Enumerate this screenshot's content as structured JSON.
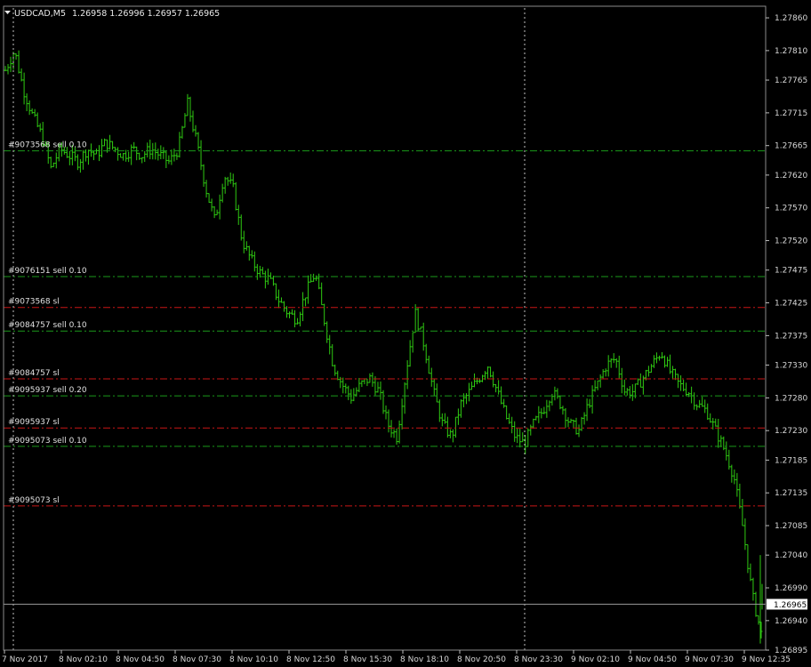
{
  "header": {
    "symbol": "USDCAD,M5",
    "ohlc": "1.26958 1.26996 1.26957 1.26965",
    "menu_icon": "triangle-down-icon"
  },
  "colors": {
    "background": "#000000",
    "candle": "#2fcb12",
    "sell_line": "#1a9a1a",
    "sl_line": "#c81616",
    "grid": "#c0c0c0",
    "frame": "#8a8a8a",
    "current_price_box": "#ffffff"
  },
  "orders": [
    {
      "text": "#9073568 sell 0.10",
      "price": 1.27657,
      "kind": "sell"
    },
    {
      "text": "#9076151 sell 0.10",
      "price": 1.27465,
      "kind": "sell"
    },
    {
      "text": "#9073568 sl",
      "price": 1.27418,
      "kind": "sl"
    },
    {
      "text": "#9084757 sell 0.10",
      "price": 1.27382,
      "kind": "sell"
    },
    {
      "text": "#9084757 sl",
      "price": 1.27309,
      "kind": "sl"
    },
    {
      "text": "#9095937 sell 0.20",
      "price": 1.27283,
      "kind": "sell"
    },
    {
      "text": "#9095937 sl",
      "price": 1.27234,
      "kind": "sl"
    },
    {
      "text": "#9095073 sell 0.10",
      "price": 1.27206,
      "kind": "sell"
    },
    {
      "text": "#9095073 sl",
      "price": 1.27115,
      "kind": "sl"
    }
  ],
  "current_price": "1.26965",
  "chart_data": {
    "type": "line",
    "title": "USDCAD,M5",
    "ylim": [
      1.26895,
      1.27875
    ],
    "y_ticks": [
      "1.27860",
      "1.27810",
      "1.27765",
      "1.27715",
      "1.27665",
      "1.27620",
      "1.27570",
      "1.27520",
      "1.27475",
      "1.27425",
      "1.27375",
      "1.27330",
      "1.27280",
      "1.27230",
      "1.27185",
      "1.27135",
      "1.27085",
      "1.27040",
      "1.26990",
      "1.26940",
      "1.26895"
    ],
    "x_ticks": [
      "7 Nov 2017",
      "8 Nov 02:10",
      "8 Nov 04:50",
      "8 Nov 07:30",
      "8 Nov 10:10",
      "8 Nov 12:50",
      "8 Nov 15:30",
      "8 Nov 18:10",
      "8 Nov 20:50",
      "8 Nov 23:30",
      "9 Nov 02:10",
      "9 Nov 04:50",
      "9 Nov 07:30",
      "9 Nov 12:35"
    ],
    "series": [
      {
        "values": [
          1.2778,
          1.2781,
          1.2775,
          1.2771,
          1.2768,
          1.2763,
          1.2766,
          1.2765,
          1.2764,
          1.2766,
          1.2765,
          1.2767,
          1.2766,
          1.2765,
          1.2766,
          1.2765,
          1.2766,
          1.2765,
          1.2764,
          1.2766,
          1.2773,
          1.2767,
          1.276,
          1.2755,
          1.2762,
          1.276,
          1.2752,
          1.2749,
          1.2747,
          1.2746,
          1.2743,
          1.2741,
          1.274,
          1.2744,
          1.2747,
          1.274,
          1.2733,
          1.273,
          1.2728,
          1.273,
          1.2731,
          1.2729,
          1.2724,
          1.2722,
          1.2732,
          1.2741,
          1.2736,
          1.2729,
          1.2724,
          1.2722,
          1.2727,
          1.2729,
          1.2731,
          1.2733,
          1.2729,
          1.2725,
          1.2722,
          1.2721,
          1.2724,
          1.2726,
          1.2729,
          1.2727,
          1.2724,
          1.2723,
          1.2727,
          1.273,
          1.2733,
          1.2734,
          1.2729,
          1.2729,
          1.2731,
          1.2733,
          1.2735,
          1.2732,
          1.273,
          1.2729,
          1.2727,
          1.2726,
          1.2723,
          1.272,
          1.2716,
          1.2708,
          1.2698,
          1.2692
        ]
      }
    ]
  }
}
